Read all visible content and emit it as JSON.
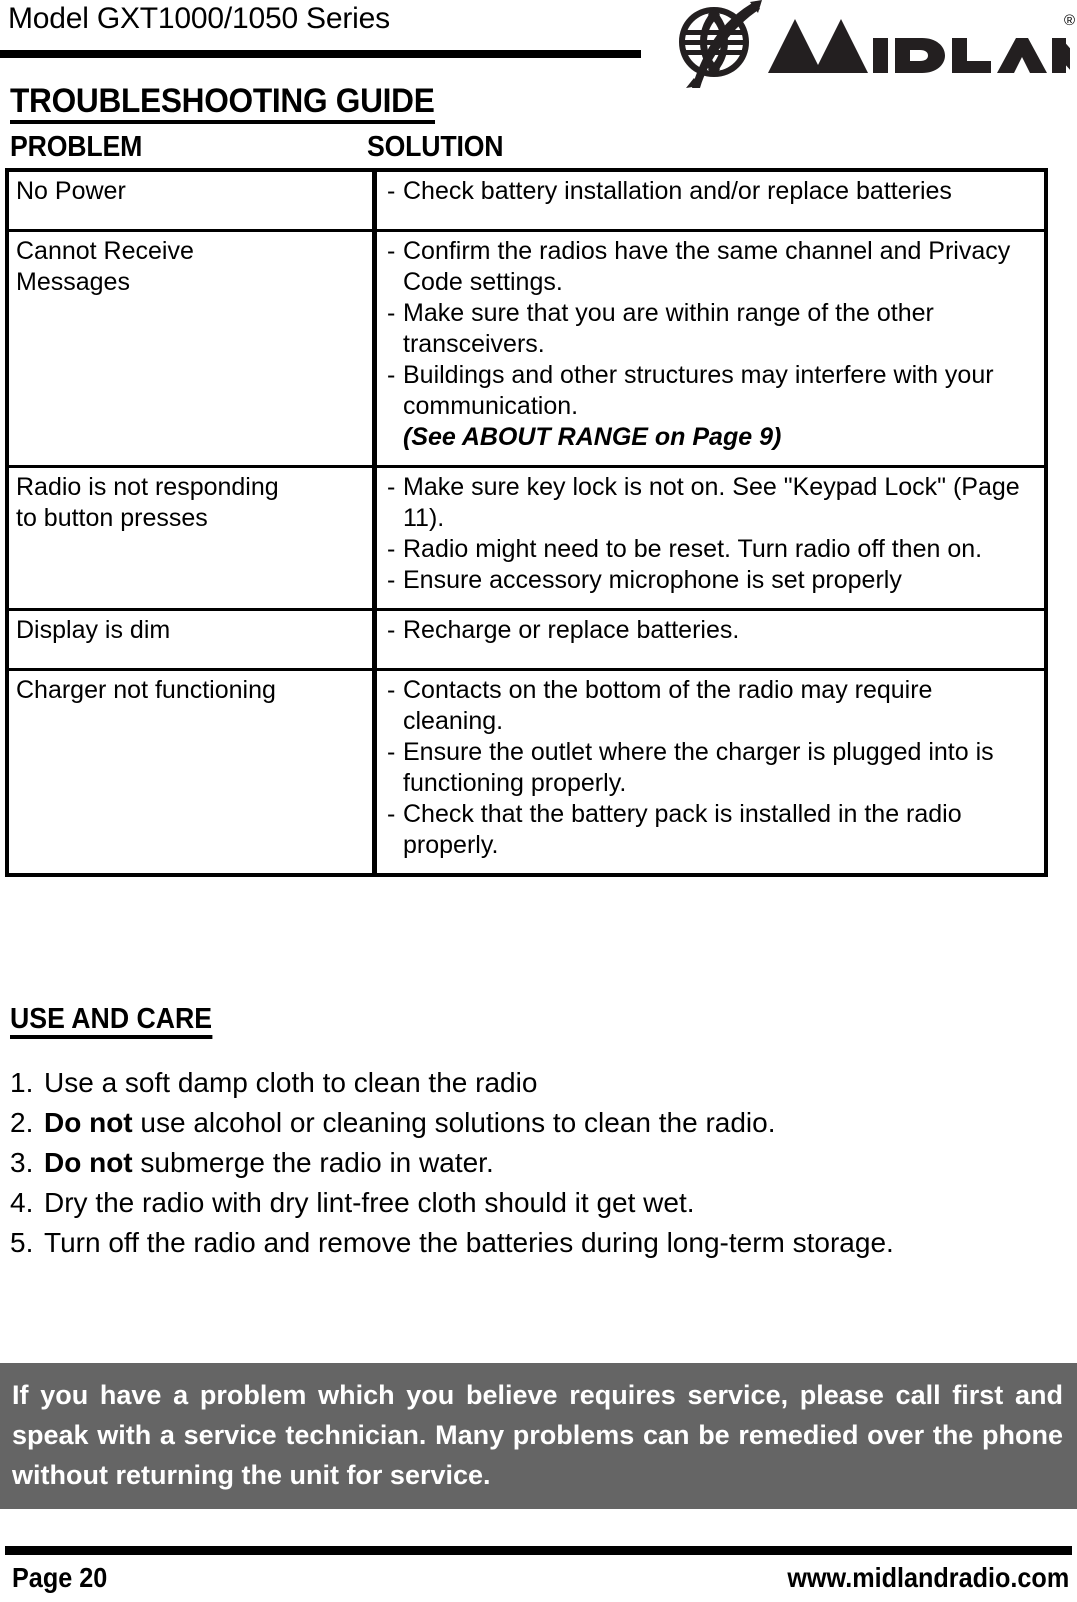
{
  "header": {
    "model": "Model GXT1000/1050 Series",
    "brand": "MIDLAND",
    "brand_trademark": "®",
    "logo_icon": "globe-icon"
  },
  "titles": {
    "guide": "TROUBLESHOOTING GUIDE",
    "col_problem": "PROBLEM",
    "col_solution": "SOLUTION"
  },
  "table": {
    "columns": [
      "PROBLEM",
      "SOLUTION"
    ],
    "rows": [
      {
        "problem": "No Power",
        "solutions": [
          "Check battery installation and/or replace batteries"
        ],
        "note": ""
      },
      {
        "problem": "Cannot Receive\nMessages",
        "solutions": [
          "Confirm the radios have the same channel and Privacy Code settings.",
          "Make sure that you are within range of the other transceivers.",
          "Buildings and other structures may interfere with your communication."
        ],
        "note": "(See ABOUT RANGE on Page 9)"
      },
      {
        "problem": "Radio is not responding\nto button presses",
        "solutions": [
          "Make sure key lock is not on. See \"Keypad Lock\" (Page 11).",
          "Radio might need to be reset.  Turn radio off then on.",
          "Ensure accessory microphone is set properly"
        ],
        "note": ""
      },
      {
        "problem": "Display is dim",
        "solutions": [
          "Recharge or replace batteries."
        ],
        "note": ""
      },
      {
        "problem": "Charger not functioning",
        "solutions": [
          "Contacts on the bottom of the radio may require cleaning.",
          "Ensure the outlet where the charger is plugged into is functioning properly.",
          "Check that the battery pack is installed in the radio properly."
        ],
        "note": ""
      }
    ],
    "dash": "-"
  },
  "use_and_care": {
    "title": "USE AND CARE",
    "items": [
      {
        "num": "1.",
        "pre": "",
        "bold": "",
        "text": "Use a soft damp cloth to clean the radio"
      },
      {
        "num": "2.",
        "pre": "",
        "bold": "Do not",
        "text": " use alcohol or cleaning solutions to clean the radio."
      },
      {
        "num": "3.",
        "pre": "",
        "bold": "Do not",
        "text": " submerge the radio in water."
      },
      {
        "num": "4.",
        "pre": "",
        "bold": "",
        "text": "Dry the radio with dry lint-free cloth should it get wet."
      },
      {
        "num": "5.",
        "pre": "",
        "bold": "",
        "text": "Turn off the radio and remove the batteries during long-term storage."
      }
    ]
  },
  "notice": {
    "text": "If you have a problem which you believe requires service, please call first and speak with a service technician.  Many problems can be remedied over the phone without returning the unit for service."
  },
  "footer": {
    "page": "Page 20",
    "website": "www.midlandradio.com"
  },
  "colors": {
    "notice_background": "#656565",
    "notice_text": "#ffffff",
    "ink": "#000000",
    "paper": "#ffffff"
  }
}
